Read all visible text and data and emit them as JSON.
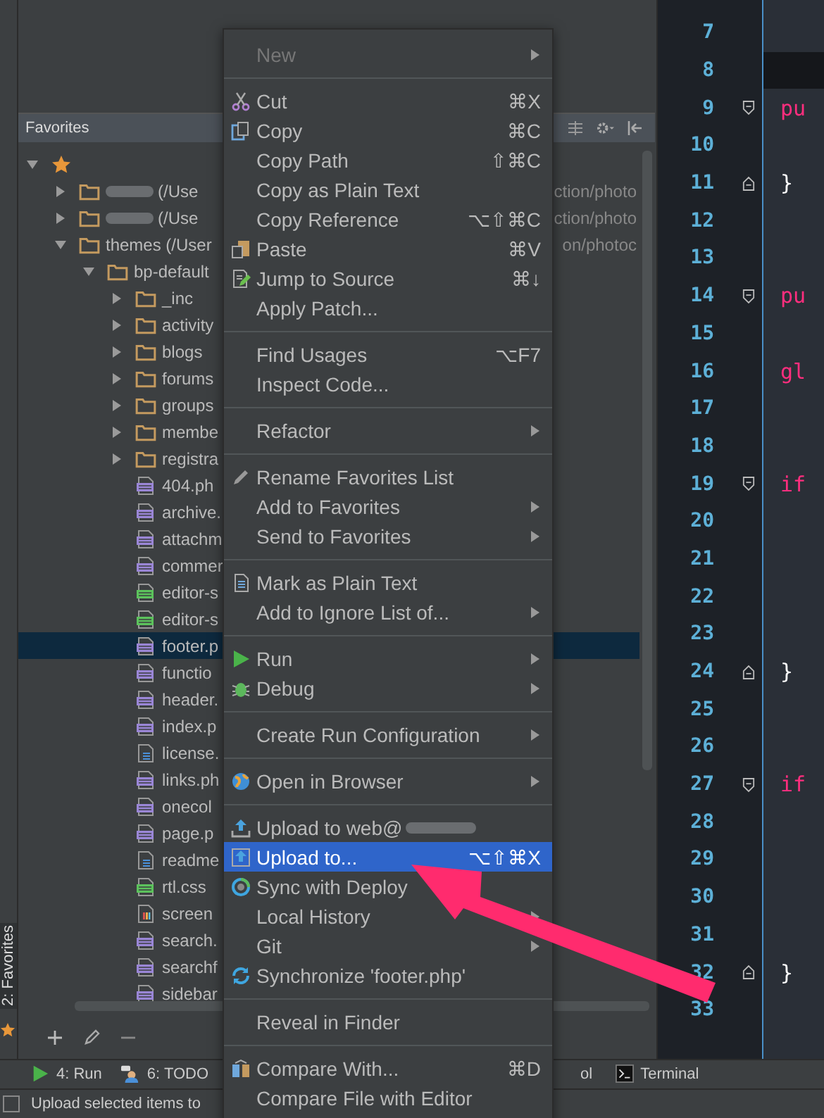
{
  "panel": {
    "title": "Favorites",
    "tree": [
      {
        "kind": "root",
        "expanded": true,
        "children": [
          {
            "kind": "folder",
            "label": "(/Use",
            "tail": "ction/photo",
            "expanded": false,
            "redacted": true
          },
          {
            "kind": "folder",
            "label": "(/Use",
            "tail": "ction/photo",
            "expanded": false,
            "redacted": true
          },
          {
            "kind": "folder",
            "label": "themes (/User",
            "tail": "on/photoc",
            "expanded": true,
            "children": [
              {
                "kind": "folder",
                "label": "bp-default",
                "expanded": true,
                "children": [
                  {
                    "kind": "folder",
                    "label": "_inc",
                    "expanded": false
                  },
                  {
                    "kind": "folder",
                    "label": "activity",
                    "expanded": false
                  },
                  {
                    "kind": "folder",
                    "label": "blogs",
                    "expanded": false
                  },
                  {
                    "kind": "folder",
                    "label": "forums",
                    "expanded": false
                  },
                  {
                    "kind": "folder",
                    "label": "groups",
                    "expanded": false
                  },
                  {
                    "kind": "folder",
                    "label": "membe",
                    "expanded": false
                  },
                  {
                    "kind": "folder",
                    "label": "registra",
                    "expanded": false
                  },
                  {
                    "kind": "php",
                    "label": "404.ph",
                    "selected": false
                  },
                  {
                    "kind": "php",
                    "label": "archive.",
                    "selected": false
                  },
                  {
                    "kind": "php",
                    "label": "attachm",
                    "selected": false
                  },
                  {
                    "kind": "php",
                    "label": "commer",
                    "selected": false
                  },
                  {
                    "kind": "css",
                    "label": "editor-s",
                    "selected": false
                  },
                  {
                    "kind": "css",
                    "label": "editor-s",
                    "selected": false
                  },
                  {
                    "kind": "php",
                    "label": "footer.p",
                    "selected": true
                  },
                  {
                    "kind": "php",
                    "label": "functio",
                    "selected": false
                  },
                  {
                    "kind": "php",
                    "label": "header.",
                    "selected": false
                  },
                  {
                    "kind": "php",
                    "label": "index.p",
                    "selected": false
                  },
                  {
                    "kind": "text",
                    "label": "license.",
                    "selected": false
                  },
                  {
                    "kind": "php",
                    "label": "links.ph",
                    "selected": false
                  },
                  {
                    "kind": "php",
                    "label": "onecol",
                    "selected": false
                  },
                  {
                    "kind": "php",
                    "label": "page.p",
                    "selected": false
                  },
                  {
                    "kind": "text",
                    "label": "readme",
                    "selected": false
                  },
                  {
                    "kind": "css",
                    "label": "rtl.css",
                    "selected": false
                  },
                  {
                    "kind": "image",
                    "label": "screen",
                    "selected": false
                  },
                  {
                    "kind": "php",
                    "label": "search.",
                    "selected": false
                  },
                  {
                    "kind": "php",
                    "label": "searchf",
                    "selected": false
                  },
                  {
                    "kind": "php",
                    "label": "sidebar",
                    "selected": false
                  }
                ]
              }
            ]
          }
        ]
      }
    ]
  },
  "side_tab": {
    "label": "2: Favorites"
  },
  "editor": {
    "lines": [
      {
        "number": "7",
        "current": false
      },
      {
        "number": "8",
        "current": true
      },
      {
        "number": "9",
        "code": "pu",
        "kind": "keyword",
        "fold_open": true,
        "current": false
      },
      {
        "number": "10",
        "current": false
      },
      {
        "number": "11",
        "code": "}",
        "kind": "brace",
        "fold_close": true,
        "current": false
      },
      {
        "number": "12",
        "current": false
      },
      {
        "number": "13",
        "current": false
      },
      {
        "number": "14",
        "code": "pu",
        "kind": "keyword",
        "fold_open": true,
        "current": false
      },
      {
        "number": "15",
        "current": false
      },
      {
        "number": "16",
        "code": "gl",
        "kind": "keyword",
        "current": false
      },
      {
        "number": "17",
        "current": false
      },
      {
        "number": "18",
        "current": false
      },
      {
        "number": "19",
        "code": "if",
        "kind": "keyword",
        "fold_open": true,
        "current": false
      },
      {
        "number": "20",
        "current": false
      },
      {
        "number": "21",
        "current": false
      },
      {
        "number": "22",
        "current": false
      },
      {
        "number": "23",
        "current": false
      },
      {
        "number": "24",
        "code": "}",
        "kind": "brace",
        "fold_close": true,
        "current": false
      },
      {
        "number": "25",
        "current": false
      },
      {
        "number": "26",
        "current": false
      },
      {
        "number": "27",
        "code": "if",
        "kind": "keyword",
        "fold_open": true,
        "current": false
      },
      {
        "number": "28",
        "current": false
      },
      {
        "number": "29",
        "current": false
      },
      {
        "number": "30",
        "current": false
      },
      {
        "number": "31",
        "current": false
      },
      {
        "number": "32",
        "code": "}",
        "kind": "brace",
        "fold_close": true,
        "current": false
      },
      {
        "number": "33",
        "current": false
      }
    ]
  },
  "context_menu": [
    {
      "kind": "item",
      "label": "New",
      "submenu": true,
      "disabled": true
    },
    {
      "kind": "separator"
    },
    {
      "kind": "item",
      "label": "Cut",
      "shortcut": "⌘X"
    },
    {
      "kind": "item",
      "label": "Copy",
      "shortcut": "⌘C"
    },
    {
      "kind": "item",
      "label": "Copy Path",
      "shortcut": "⇧⌘C"
    },
    {
      "kind": "item",
      "label": "Copy as Plain Text"
    },
    {
      "kind": "item",
      "label": "Copy Reference",
      "shortcut": "⌥⇧⌘C"
    },
    {
      "kind": "item",
      "label": "Paste",
      "shortcut": "⌘V"
    },
    {
      "kind": "item",
      "label": "Jump to Source",
      "shortcut": "⌘↓"
    },
    {
      "kind": "item",
      "label": "Apply Patch..."
    },
    {
      "kind": "separator"
    },
    {
      "kind": "item",
      "label": "Find Usages",
      "shortcut": "⌥F7"
    },
    {
      "kind": "item",
      "label": "Inspect Code..."
    },
    {
      "kind": "separator"
    },
    {
      "kind": "item",
      "label": "Refactor",
      "submenu": true
    },
    {
      "kind": "separator"
    },
    {
      "kind": "item",
      "label": "Rename Favorites List"
    },
    {
      "kind": "item",
      "label": "Add to Favorites",
      "submenu": true
    },
    {
      "kind": "item",
      "label": "Send to Favorites",
      "submenu": true
    },
    {
      "kind": "separator"
    },
    {
      "kind": "item",
      "label": "Mark as Plain Text"
    },
    {
      "kind": "item",
      "label": "Add to Ignore List of...",
      "submenu": true
    },
    {
      "kind": "separator"
    },
    {
      "kind": "item",
      "label": "Run",
      "submenu": true
    },
    {
      "kind": "item",
      "label": "Debug",
      "submenu": true
    },
    {
      "kind": "separator"
    },
    {
      "kind": "item",
      "label": "Create Run Configuration",
      "submenu": true
    },
    {
      "kind": "separator"
    },
    {
      "kind": "item",
      "label": "Open in Browser",
      "submenu": true
    },
    {
      "kind": "separator"
    },
    {
      "kind": "item",
      "label": "Upload to web@",
      "redacted": true
    },
    {
      "kind": "item",
      "label": "Upload to...",
      "shortcut": "⌥⇧⌘X",
      "selected": true
    },
    {
      "kind": "item",
      "label": "Sync with Deploy"
    },
    {
      "kind": "item",
      "label": "Local History",
      "submenu": true
    },
    {
      "kind": "item",
      "label": "Git",
      "submenu": true
    },
    {
      "kind": "item",
      "label": "Synchronize 'footer.php'"
    },
    {
      "kind": "separator"
    },
    {
      "kind": "item",
      "label": "Reveal in Finder"
    },
    {
      "kind": "separator"
    },
    {
      "kind": "item",
      "label": "Compare With...",
      "shortcut": "⌘D"
    },
    {
      "kind": "item",
      "label": "Compare File with Editor"
    }
  ],
  "tool_windows": [
    {
      "label": "4: Run"
    },
    {
      "label": "6: TODO"
    },
    {
      "label": "ol"
    },
    {
      "label": "Terminal"
    }
  ],
  "status_bar": {
    "message": "Upload selected items to"
  }
}
